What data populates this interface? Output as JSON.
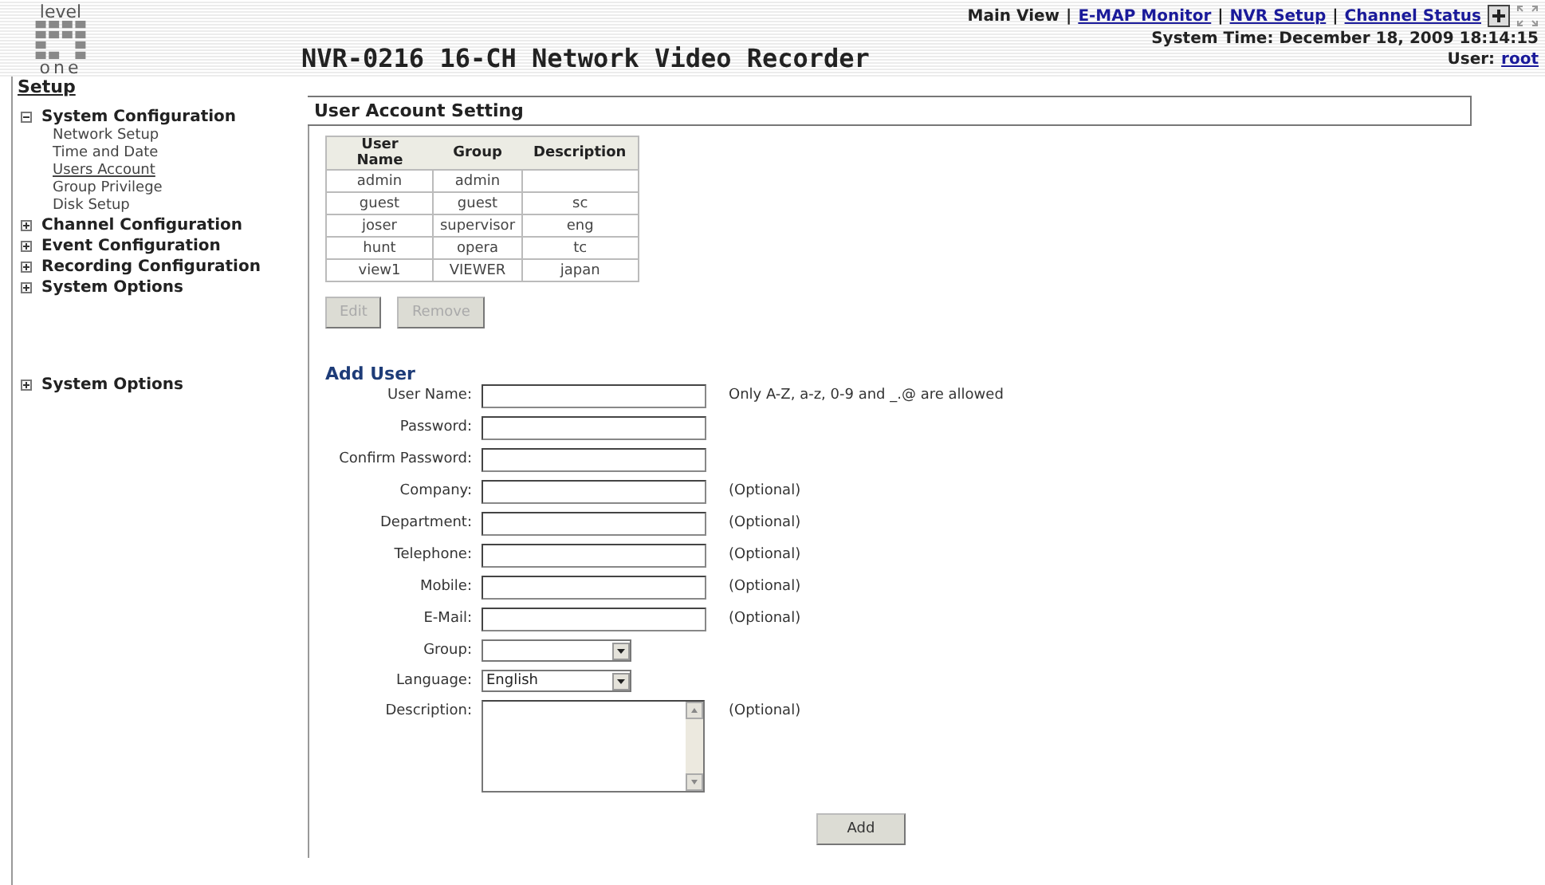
{
  "logo": {
    "top": "level",
    "bottom": "one"
  },
  "title": "NVR-0216 16-CH Network Video Recorder",
  "nav": {
    "separator": "|",
    "links": [
      {
        "label": "Main View",
        "link": false
      },
      {
        "label": "E-MAP Monitor",
        "link": true
      },
      {
        "label": "NVR Setup",
        "link": true
      },
      {
        "label": "Channel Status",
        "link": true
      }
    ]
  },
  "system_time": "System Time: December 18, 2009 18:14:15",
  "user": {
    "label": "User:",
    "name": "root"
  },
  "sidebar": {
    "heading": "Setup",
    "items": [
      {
        "label": "System Configuration",
        "expanded": true,
        "children": [
          {
            "label": "Network Setup",
            "selected": false
          },
          {
            "label": "Time and Date",
            "selected": false
          },
          {
            "label": "Users Account",
            "selected": true
          },
          {
            "label": "Group Privilege",
            "selected": false
          },
          {
            "label": "Disk Setup",
            "selected": false
          }
        ]
      },
      {
        "label": "Channel Configuration",
        "expanded": false
      },
      {
        "label": "Event Configuration",
        "expanded": false
      },
      {
        "label": "Recording Configuration",
        "expanded": false
      },
      {
        "label": "System Options",
        "expanded": false
      }
    ],
    "extra_items": [
      {
        "label": "System Options",
        "expanded": false
      }
    ]
  },
  "section_title": "User Account Setting",
  "table": {
    "columns": [
      "User Name",
      "Group",
      "Description"
    ],
    "rows": [
      [
        "admin",
        "admin",
        ""
      ],
      [
        "guest",
        "guest",
        "sc"
      ],
      [
        "joser",
        "supervisor",
        "eng"
      ],
      [
        "hunt",
        "opera",
        "tc"
      ],
      [
        "view1",
        "VIEWER",
        "japan"
      ]
    ]
  },
  "table_buttons": [
    {
      "label": "Edit",
      "disabled": true
    },
    {
      "label": "Remove",
      "disabled": true
    }
  ],
  "add_user": {
    "title": "Add User",
    "fields": [
      {
        "kind": "text",
        "label": "User Name:",
        "hint": "Only A-Z, a-z, 0-9 and _.@ are allowed"
      },
      {
        "kind": "text",
        "label": "Password:"
      },
      {
        "kind": "text",
        "label": "Confirm Password:"
      },
      {
        "kind": "text",
        "label": "Company:",
        "hint": "(Optional)"
      },
      {
        "kind": "text",
        "label": "Department:",
        "hint": "(Optional)"
      },
      {
        "kind": "text",
        "label": "Telephone:",
        "hint": "(Optional)"
      },
      {
        "kind": "text",
        "label": "Mobile:",
        "hint": "(Optional)"
      },
      {
        "kind": "text",
        "label": "E-Mail:",
        "hint": "(Optional)"
      },
      {
        "kind": "select",
        "label": "Group:"
      },
      {
        "kind": "select",
        "label": "Language:",
        "value": "English"
      },
      {
        "kind": "textarea",
        "label": "Description:",
        "hint": "(Optional)"
      }
    ],
    "submit": "Add"
  }
}
